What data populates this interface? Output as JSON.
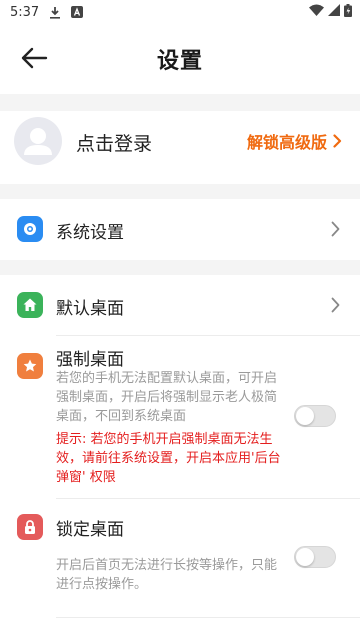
{
  "status_bar": {
    "time": "5:37",
    "icons": [
      "download-icon",
      "notification-a-icon",
      "wifi-icon",
      "signal-icon",
      "battery-icon"
    ]
  },
  "app_bar": {
    "title": "设置",
    "back_icon": "arrow-left-icon"
  },
  "account": {
    "login_label": "点击登录",
    "unlock_label": "解锁高级版",
    "unlock_color": "#f06a10"
  },
  "system": {
    "label": "系统设置",
    "icon": "gear-icon",
    "icon_color": "#2a8cf2"
  },
  "launcher": {
    "default_desktop": {
      "label": "默认桌面",
      "icon": "home-icon",
      "icon_color": "#3bb35a"
    },
    "force_desktop": {
      "label": "强制桌面",
      "icon": "star-icon",
      "icon_color": "#f07f3e",
      "description": "若您的手机无法配置默认桌面，可开启强制桌面，开启后将强制显示老人极简桌面，不回到系统桌面",
      "warning": "提示: 若您的手机开启强制桌面无法生效，请前往系统设置，开启本应用'后台弹窗' 权限",
      "warning_color": "#e41e1e",
      "enabled": false
    },
    "lock_desktop": {
      "label": "锁定桌面",
      "icon": "lock-icon",
      "icon_color": "#e45a5a",
      "description": "开启后首页无法进行长按等操作，只能进行点按操作。",
      "enabled": false
    }
  }
}
